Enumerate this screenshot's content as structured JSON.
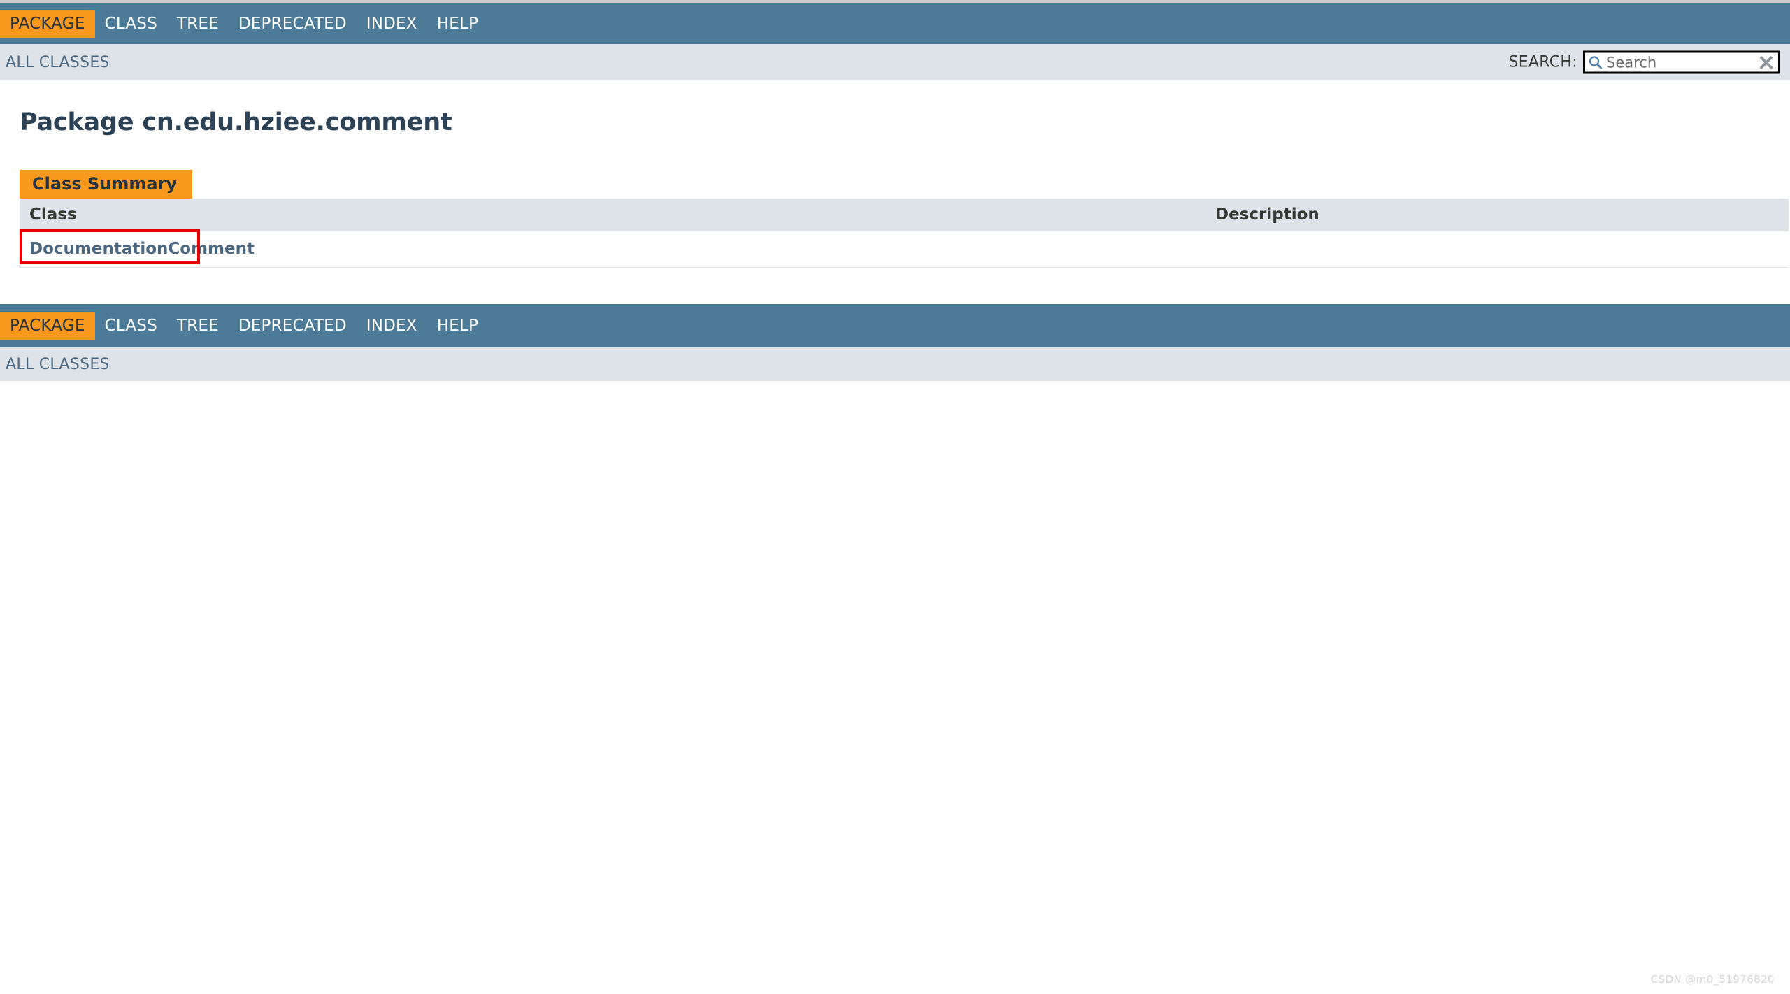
{
  "page": {
    "title": "Package cn.edu.hziee.comment"
  },
  "nav_top": {
    "items": [
      {
        "label": "PACKAGE",
        "active": true
      },
      {
        "label": "CLASS",
        "active": false
      },
      {
        "label": "TREE",
        "active": false
      },
      {
        "label": "DEPRECATED",
        "active": false
      },
      {
        "label": "INDEX",
        "active": false
      },
      {
        "label": "HELP",
        "active": false
      }
    ]
  },
  "nav_bottom": {
    "items": [
      {
        "label": "PACKAGE",
        "active": true
      },
      {
        "label": "CLASS",
        "active": false
      },
      {
        "label": "TREE",
        "active": false
      },
      {
        "label": "DEPRECATED",
        "active": false
      },
      {
        "label": "INDEX",
        "active": false
      },
      {
        "label": "HELP",
        "active": false
      }
    ]
  },
  "subnav_top": {
    "all_classes_label": "ALL CLASSES"
  },
  "subnav_bottom": {
    "all_classes_label": "ALL CLASSES"
  },
  "search": {
    "label": "SEARCH:",
    "placeholder": "Search",
    "value": "",
    "search_icon": "magnifier-icon",
    "reset_icon": "clear-x-icon"
  },
  "summary": {
    "caption": "Class Summary",
    "columns": [
      "Class",
      "Description"
    ],
    "rows": [
      {
        "class_name": "DocumentationComment",
        "description": ""
      }
    ]
  },
  "annotation": {
    "target": "DocumentationComment",
    "color": "#e60000"
  },
  "watermark": {
    "text": "CSDN @m0_51976820"
  },
  "colors": {
    "navbar_blue": "#4d7a97",
    "accent_orange": "#f8981d",
    "subnav_gray": "#dee3e9",
    "link_blue": "#4a6782",
    "title_navy": "#2c4257",
    "annotation_red": "#e60000"
  }
}
